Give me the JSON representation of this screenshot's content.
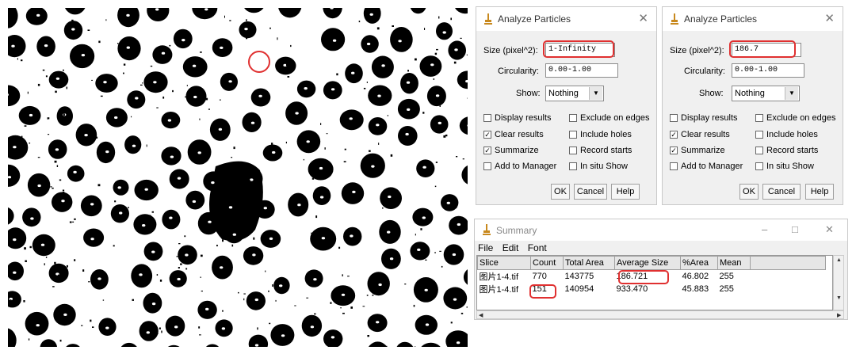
{
  "dialogs": [
    {
      "title": "Analyze Particles",
      "size_label": "Size (pixel^2):",
      "size_value": "1-Infinity",
      "circularity_label": "Circularity:",
      "circularity_value": "0.00-1.00",
      "show_label": "Show:",
      "show_value": "Nothing",
      "checkboxes": [
        {
          "label": "Display results",
          "checked": false
        },
        {
          "label": "Exclude on edges",
          "checked": false
        },
        {
          "label": "Clear results",
          "checked": true
        },
        {
          "label": "Include holes",
          "checked": false
        },
        {
          "label": "Summarize",
          "checked": true
        },
        {
          "label": "Record starts",
          "checked": false
        },
        {
          "label": "Add to Manager",
          "checked": false
        },
        {
          "label": "In situ Show",
          "checked": false
        }
      ],
      "buttons": {
        "ok": "OK",
        "cancel": "Cancel",
        "help": "Help"
      }
    },
    {
      "title": "Analyze Particles",
      "size_label": "Size (pixel^2):",
      "size_value": "186.7",
      "circularity_label": "Circularity:",
      "circularity_value": "0.00-1.00",
      "show_label": "Show:",
      "show_value": "Nothing",
      "checkboxes": [
        {
          "label": "Display results",
          "checked": false
        },
        {
          "label": "Exclude on edges",
          "checked": false
        },
        {
          "label": "Clear results",
          "checked": true
        },
        {
          "label": "Include holes",
          "checked": false
        },
        {
          "label": "Summarize",
          "checked": true
        },
        {
          "label": "Record starts",
          "checked": false
        },
        {
          "label": "Add to Manager",
          "checked": false
        },
        {
          "label": "In situ Show",
          "checked": false
        }
      ],
      "buttons": {
        "ok": "OK",
        "cancel": "Cancel",
        "help": "Help"
      }
    }
  ],
  "summary": {
    "title": "Summary",
    "window_controls": {
      "minimize": "–",
      "maximize": "□",
      "close": "✕"
    },
    "menu": [
      "File",
      "Edit",
      "Font"
    ],
    "columns": [
      "Slice",
      "Count",
      "Total Area",
      "Average Size",
      "%Area",
      "Mean"
    ],
    "rows": [
      [
        "图片1-4.tif",
        "770",
        "143775",
        "186.721",
        "46.802",
        "255"
      ],
      [
        "图片1-4.tif",
        "151",
        "140954",
        "933.470",
        "45.883",
        "255"
      ]
    ]
  },
  "colors": {
    "highlight": "#e03030",
    "icon": "#c8891e"
  }
}
